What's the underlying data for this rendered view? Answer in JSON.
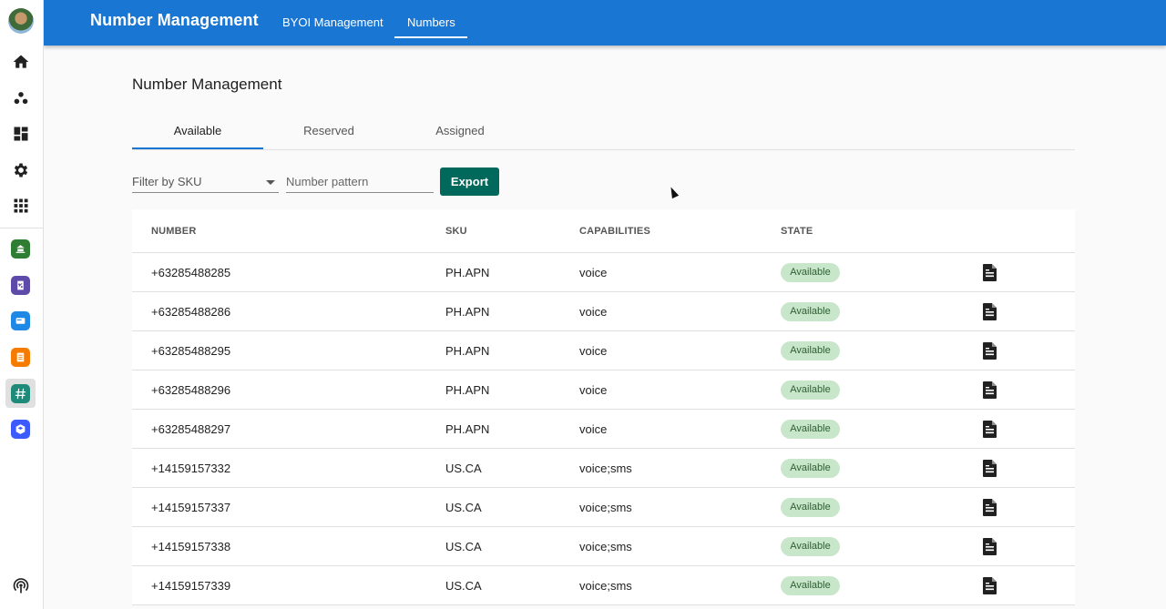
{
  "topbar": {
    "title": "Number Management",
    "nav": [
      {
        "label": "BYOI Management"
      },
      {
        "label": "Numbers"
      }
    ],
    "color": "#1976d2"
  },
  "rail": {
    "icons": [
      "home-icon",
      "group-icon",
      "dashboard-icon",
      "settings-icon",
      "apps-grid-icon"
    ],
    "apps": [
      {
        "name": "app-green-icon",
        "color": "#2e7d32"
      },
      {
        "name": "app-purple-icon",
        "color": "#5e4aa8"
      },
      {
        "name": "app-blue-icon",
        "color": "#1e88e5"
      },
      {
        "name": "app-orange-icon",
        "color": "#f57c00"
      },
      {
        "name": "app-hash-icon",
        "color": "#1e8a7a"
      },
      {
        "name": "app-box-icon",
        "color": "#3d5afe"
      }
    ],
    "bottom_icon": "broadcast-icon"
  },
  "page": {
    "title": "Number Management",
    "tabs": [
      {
        "label": "Available"
      },
      {
        "label": "Reserved"
      },
      {
        "label": "Assigned"
      }
    ],
    "filter_sku": {
      "label": "Filter by SKU"
    },
    "pattern": {
      "placeholder": "Number pattern",
      "value": ""
    },
    "export_label": "Export",
    "export_color": "#00695c"
  },
  "table": {
    "headers": [
      "NUMBER",
      "SKU",
      "CAPABILITIES",
      "STATE"
    ],
    "rows": [
      {
        "number": "+63285488285",
        "sku": "PH.APN",
        "capabilities": "voice",
        "state": "Available"
      },
      {
        "number": "+63285488286",
        "sku": "PH.APN",
        "capabilities": "voice",
        "state": "Available"
      },
      {
        "number": "+63285488295",
        "sku": "PH.APN",
        "capabilities": "voice",
        "state": "Available"
      },
      {
        "number": "+63285488296",
        "sku": "PH.APN",
        "capabilities": "voice",
        "state": "Available"
      },
      {
        "number": "+63285488297",
        "sku": "PH.APN",
        "capabilities": "voice",
        "state": "Available"
      },
      {
        "number": "+14159157332",
        "sku": "US.CA",
        "capabilities": "voice;sms",
        "state": "Available"
      },
      {
        "number": "+14159157337",
        "sku": "US.CA",
        "capabilities": "voice;sms",
        "state": "Available"
      },
      {
        "number": "+14159157338",
        "sku": "US.CA",
        "capabilities": "voice;sms",
        "state": "Available"
      },
      {
        "number": "+14159157339",
        "sku": "US.CA",
        "capabilities": "voice;sms",
        "state": "Available"
      }
    ],
    "badge_color": "#c8e6c9"
  }
}
